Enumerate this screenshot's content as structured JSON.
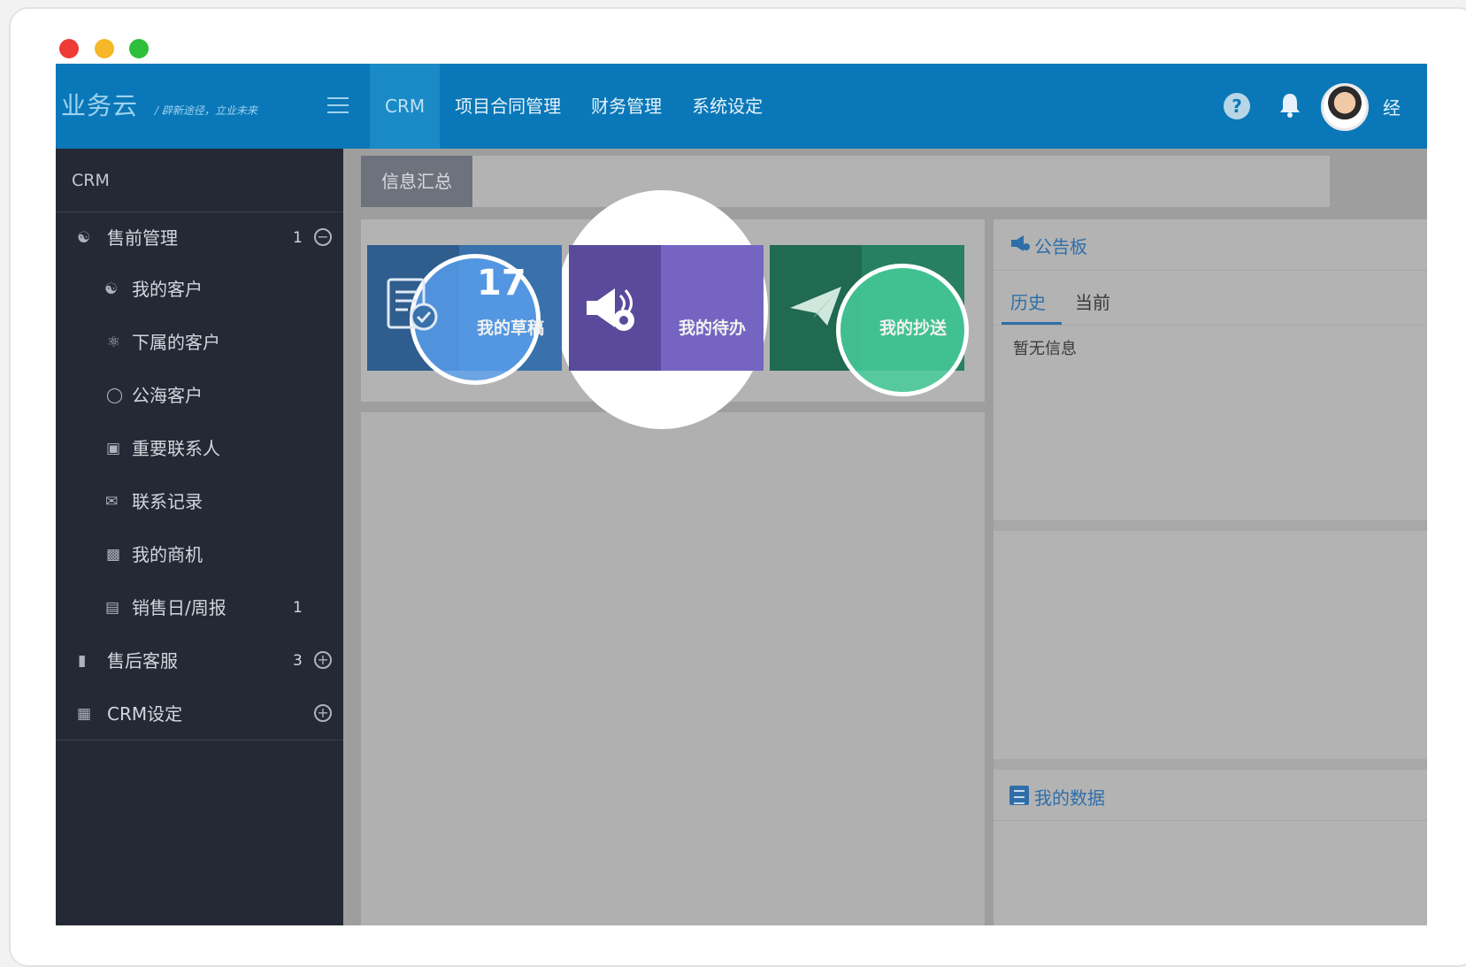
{
  "window": {
    "controls": [
      "close",
      "minimize",
      "maximize"
    ]
  },
  "header": {
    "brand": "业务云",
    "brand_sub": "/ 辟新途径，立业未来",
    "menu_icon": "hamburger-icon",
    "nav": [
      {
        "label": "CRM",
        "active": true
      },
      {
        "label": "项目合同管理",
        "active": false
      },
      {
        "label": "财务管理",
        "active": false
      },
      {
        "label": "系统设定",
        "active": false
      }
    ],
    "icons": [
      "help-icon",
      "bell-icon"
    ],
    "user_name": "经"
  },
  "sidebar": {
    "title": "CRM",
    "groups": [
      {
        "label": "售前管理",
        "count": "1",
        "icon": "team-icon",
        "expanded": true
      },
      {
        "label": "售后客服",
        "count": "3",
        "icon": "book-icon",
        "expanded": false
      },
      {
        "label": "CRM设定",
        "count": "",
        "icon": "grid-icon",
        "expanded": false
      }
    ],
    "items": [
      {
        "label": "我的客户",
        "icon": "team-icon",
        "count": ""
      },
      {
        "label": "下属的客户",
        "icon": "user-tree-icon",
        "count": ""
      },
      {
        "label": "公海客户",
        "icon": "shield-icon",
        "count": ""
      },
      {
        "label": "重要联系人",
        "icon": "contact-card-icon",
        "count": ""
      },
      {
        "label": "联系记录",
        "icon": "mail-icon",
        "count": ""
      },
      {
        "label": "我的商机",
        "icon": "clipboard-icon",
        "count": ""
      },
      {
        "label": "销售日/周报",
        "icon": "chart-icon",
        "count": "1"
      }
    ]
  },
  "tabs": [
    {
      "label": "信息汇总",
      "active": true
    }
  ],
  "tiles": [
    {
      "label": "我的草稿",
      "count": "17",
      "icon": "document-check-icon"
    },
    {
      "label": "我的待办",
      "count": "",
      "icon": "megaphone-gear-icon"
    },
    {
      "label": "我的抄送",
      "count": "",
      "icon": "paper-plane-icon"
    }
  ],
  "notice_board": {
    "title": "公告板",
    "tabs": [
      {
        "label": "历史",
        "active": true
      },
      {
        "label": "当前",
        "active": false
      }
    ],
    "empty_text": "暂无信息"
  },
  "my_data": {
    "title": "我的数据"
  },
  "colors": {
    "topbar": "#0a78b8",
    "sidebar": "#252935",
    "tile_draft": "#3871ab",
    "tile_todo": "#7564c2",
    "tile_cc": "#268061",
    "accent_link": "#2f6ea8"
  }
}
